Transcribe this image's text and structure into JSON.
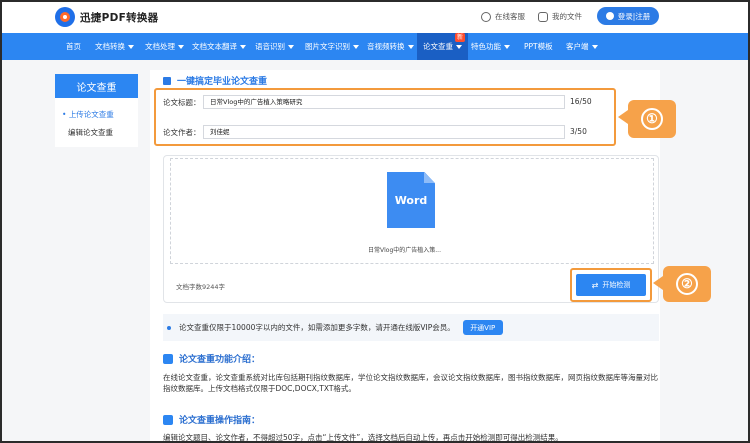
{
  "header": {
    "logo_text": "迅捷PDF转换器",
    "online_support": "在线客服",
    "my_files": "我的文件",
    "login": "登录|注册"
  },
  "nav": {
    "items": [
      {
        "label": "首页",
        "has_caret": false
      },
      {
        "label": "文档转换",
        "has_caret": true
      },
      {
        "label": "文档处理",
        "has_caret": true
      },
      {
        "label": "文档文本翻译",
        "has_caret": true
      },
      {
        "label": "语音识别",
        "has_caret": true
      },
      {
        "label": "图片文字识别",
        "has_caret": true
      },
      {
        "label": "音视频转换",
        "has_caret": true
      },
      {
        "label": "论文查重",
        "has_caret": true,
        "active": true
      },
      {
        "label": "特色功能",
        "has_caret": true
      },
      {
        "label": "PPT模板",
        "has_caret": false
      },
      {
        "label": "客户端",
        "has_caret": true
      }
    ],
    "new_badge": "新"
  },
  "sidebar": {
    "title": "论文查重",
    "items": [
      {
        "label": "上传论文查重",
        "active": true
      },
      {
        "label": "编辑论文查重",
        "active": false
      }
    ]
  },
  "main": {
    "section_title": "一键搞定毕业论文查重",
    "title_label": "论文标题：",
    "title_value": "日常Vlog中的广告植入策略研究",
    "title_count": "16/50",
    "author_label": "论文作者：",
    "author_value": "刘佳妮",
    "author_count": "3/50",
    "doc_icon_text": "Word",
    "file_name": "日常Vlog中的广告植入策...",
    "word_count": "文档字数9244字",
    "start_button": "开始检测",
    "callout_1": "①",
    "callout_2": "②",
    "notice_text": "论文查重仅限于10000字以内的文件，如需添加更多字数，请开通在线版VIP会员。",
    "vip_button": "开通VIP",
    "intro_title": "论文查重功能介绍：",
    "intro_text": "在线论文查重，论文查重系统对比库包括期刊指纹数据库，学位论文指纹数据库，会议论文指纹数据库，图书指纹数据库，网页指纹数据库等海量对比指纹数据库。上传文档格式仅限于DOC,DOCX,TXT格式。",
    "guide_title": "论文查重操作指南：",
    "guide_text": "编辑论文题目、论文作者，不得超过50字，点击“上传文件”，选择文档后自动上传，再点击开始检测即可得出检测结果。"
  },
  "colors": {
    "brand_blue": "#2c86f2",
    "highlight_orange": "#f39a3c"
  }
}
